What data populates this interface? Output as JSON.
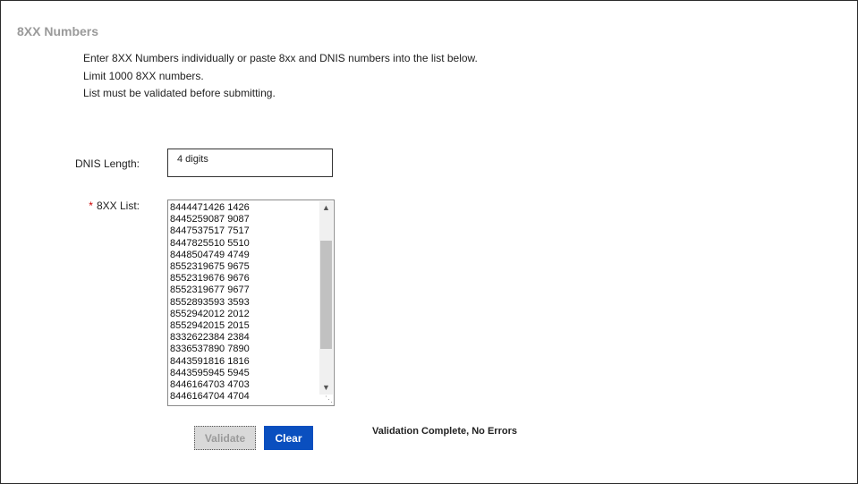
{
  "page": {
    "title": "8XX Numbers"
  },
  "instructions": [
    "Enter 8XX Numbers individually or paste 8xx and DNIS numbers into the list below.",
    "Limit 1000 8XX numbers.",
    "List must be validated before submitting."
  ],
  "dnis": {
    "label": "DNIS Length:",
    "value": "4 digits"
  },
  "list": {
    "required_marker": "*",
    "label": "8XX List:",
    "entries": [
      "8444471426 1426",
      "8445259087 9087",
      "8447537517 7517",
      "8447825510 5510",
      "8448504749 4749",
      "8552319675 9675",
      "8552319676 9676",
      "8552319677 9677",
      "8552893593 3593",
      "8552942012 2012",
      "8552942015 2015",
      "8332622384 2384",
      "8336537890 7890",
      "8443591816 1816",
      "8443595945 5945",
      "8446164703 4703",
      "8446164704 4704"
    ],
    "scroll_position": 0.45,
    "scroll_visible_fraction": 0.65
  },
  "actions": {
    "validate_label": "Validate",
    "clear_label": "Clear"
  },
  "status": {
    "message": "Validation Complete, No Errors"
  },
  "icons": {
    "scroll_up": "chevron-up-icon",
    "scroll_down": "chevron-down-icon",
    "resize": "resize-grip-icon"
  },
  "colors": {
    "title": "#9a9a9a",
    "required": "#cc0000",
    "clear_button": "#0a4fbf",
    "validate_button_disabled": "#d9d9d9"
  }
}
